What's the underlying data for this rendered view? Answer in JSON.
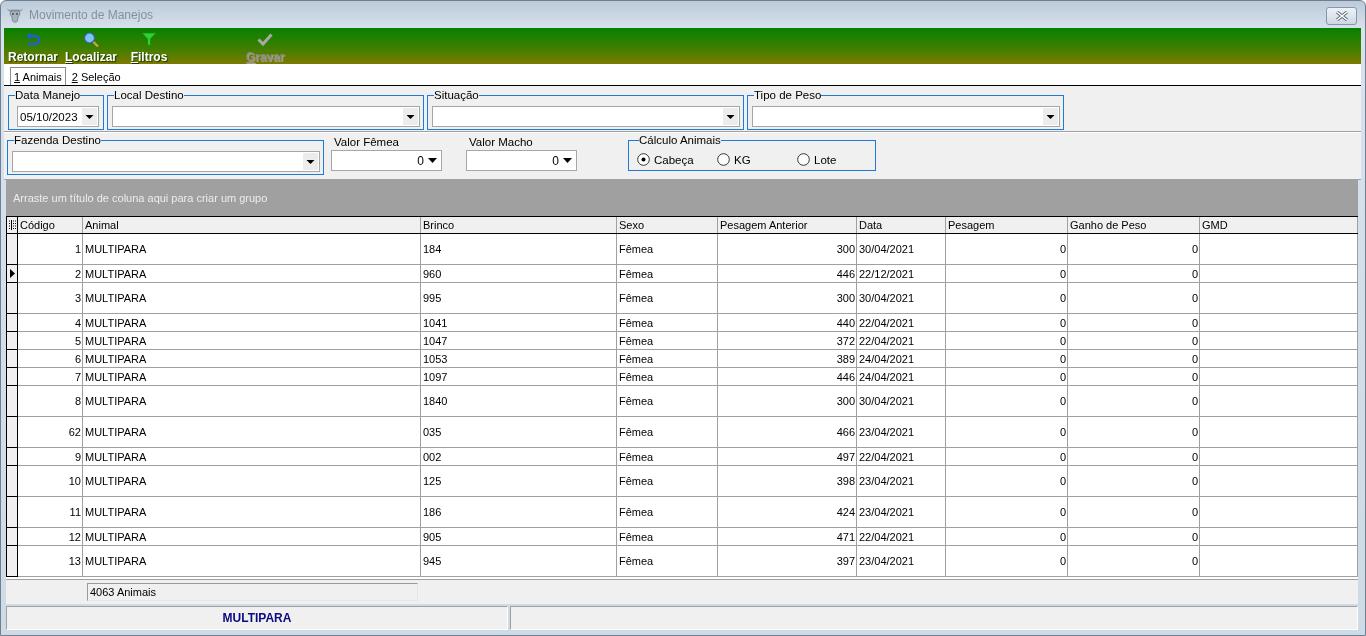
{
  "window": {
    "title": "Movimento de Manejos"
  },
  "toolbar": {
    "groups": [
      [
        {
          "label": "Retornar",
          "mnemonic": false,
          "disabled": false
        },
        {
          "label": "Localizar",
          "mnemonic": true,
          "disabled": false
        },
        {
          "label": "Filtros",
          "mnemonic": true,
          "disabled": false
        }
      ],
      [
        {
          "label": "Gravar",
          "mnemonic": true,
          "disabled": true
        }
      ]
    ]
  },
  "tabs": [
    {
      "label": "1 Animais",
      "mnemonic": true,
      "selected": true
    },
    {
      "label": "2 Seleção",
      "mnemonic": true,
      "selected": false
    }
  ],
  "form": {
    "row_1": [
      {
        "kind": "date",
        "label": "Data Manejo",
        "value": "05/10/2023"
      },
      {
        "kind": "combo",
        "label": "Local Destino"
      },
      {
        "kind": "combo",
        "label": "Situação"
      },
      {
        "kind": "combo",
        "label": "Tipo de Peso"
      }
    ],
    "row_2": [
      {
        "kind": "combo",
        "label": "Fazenda Destino"
      },
      {
        "kind": "number",
        "label": "Valor Fêmea",
        "value": "0"
      },
      {
        "kind": "number",
        "label": "Valor Macho",
        "value": "0"
      },
      {
        "kind": "radio",
        "label": "Cálculo Animais",
        "options": [
          {
            "label": "Cabeça",
            "selected": true
          },
          {
            "label": "KG",
            "selected": false
          },
          {
            "label": "Lote",
            "selected": false
          }
        ]
      }
    ]
  },
  "table": {
    "group_panel_hint": "Arraste um título de coluna aqui para criar um grupo",
    "columns": [
      {
        "title": "Código"
      },
      {
        "title": "Animal",
        "footer": "4063 Animais"
      },
      {
        "title": "Brinco"
      },
      {
        "title": "Sexo"
      },
      {
        "title": "Pesagem Anterior"
      },
      {
        "title": "Data"
      },
      {
        "title": "Pesagem"
      },
      {
        "title": "Ganho de Peso"
      },
      {
        "title": "GMD"
      }
    ],
    "rows": [
      {
        "cells": [
          "1",
          "MULTIPARA",
          "184",
          "Fêmea",
          "300",
          "30/04/2021",
          "0",
          "0"
        ],
        "selected": false,
        "tall": true
      },
      {
        "cells": [
          "2",
          "MULTIPARA",
          "960",
          "Fêmea",
          "446",
          "22/12/2021",
          "0",
          "0"
        ],
        "selected": true,
        "tall": false
      },
      {
        "cells": [
          "3",
          "MULTIPARA",
          "995",
          "Fêmea",
          "300",
          "30/04/2021",
          "0",
          "0"
        ],
        "selected": false,
        "tall": true
      },
      {
        "cells": [
          "4",
          "MULTIPARA",
          "1041",
          "Fêmea",
          "440",
          "22/04/2021",
          "0",
          "0"
        ],
        "selected": false,
        "tall": false
      },
      {
        "cells": [
          "5",
          "MULTIPARA",
          "1047",
          "Fêmea",
          "372",
          "22/04/2021",
          "0",
          "0"
        ],
        "selected": false,
        "tall": false
      },
      {
        "cells": [
          "6",
          "MULTIPARA",
          "1053",
          "Fêmea",
          "389",
          "24/04/2021",
          "0",
          "0"
        ],
        "selected": false,
        "tall": false
      },
      {
        "cells": [
          "7",
          "MULTIPARA",
          "1097",
          "Fêmea",
          "446",
          "24/04/2021",
          "0",
          "0"
        ],
        "selected": false,
        "tall": false
      },
      {
        "cells": [
          "8",
          "MULTIPARA",
          "1840",
          "Fêmea",
          "300",
          "30/04/2021",
          "0",
          "0"
        ],
        "selected": false,
        "tall": true
      },
      {
        "cells": [
          "62",
          "MULTIPARA",
          "035",
          "Fêmea",
          "466",
          "23/04/2021",
          "0",
          "0"
        ],
        "selected": false,
        "tall": true
      },
      {
        "cells": [
          "9",
          "MULTIPARA",
          "002",
          "Fêmea",
          "497",
          "22/04/2021",
          "0",
          "0"
        ],
        "selected": false,
        "tall": false
      },
      {
        "cells": [
          "10",
          "MULTIPARA",
          "125",
          "Fêmea",
          "398",
          "23/04/2021",
          "0",
          "0"
        ],
        "selected": false,
        "tall": true
      },
      {
        "cells": [
          "11",
          "MULTIPARA",
          "186",
          "Fêmea",
          "424",
          "23/04/2021",
          "0",
          "0"
        ],
        "selected": false,
        "tall": true
      },
      {
        "cells": [
          "12",
          "MULTIPARA",
          "905",
          "Fêmea",
          "471",
          "22/04/2021",
          "0",
          "0"
        ],
        "selected": false,
        "tall": false
      },
      {
        "cells": [
          "13",
          "MULTIPARA",
          "945",
          "Fêmea",
          "397",
          "23/04/2021",
          "0",
          "0"
        ],
        "selected": false,
        "tall": true
      }
    ]
  },
  "status_bar": {
    "text": "MULTIPARA"
  }
}
